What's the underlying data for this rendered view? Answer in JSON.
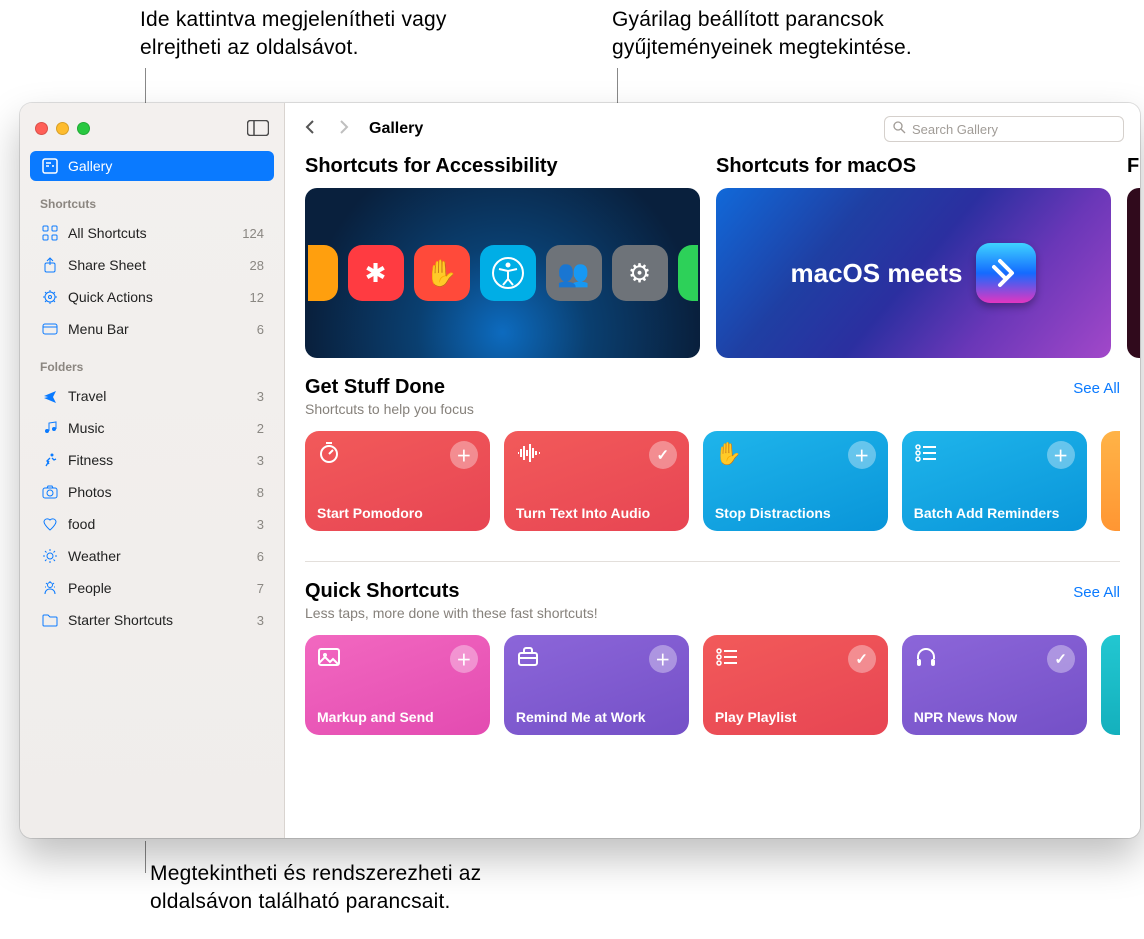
{
  "callouts": {
    "sidebar_toggle": "Ide kattintva megjelenítheti vagy elrejtheti az oldalsávot.",
    "gallery_banner": "Gyárilag beállított parancsok gyűjteményeinek megtekintése.",
    "sidebar_footer": "Megtekintheti és rendszerezheti az oldalsávon található parancsait."
  },
  "toolbar": {
    "title": "Gallery",
    "search_placeholder": "Search Gallery"
  },
  "sidebar": {
    "gallery_label": "Gallery",
    "header_shortcuts": "Shortcuts",
    "header_folders": "Folders",
    "shortcuts": [
      {
        "label": "All Shortcuts",
        "count": "124",
        "icon": "grid"
      },
      {
        "label": "Share Sheet",
        "count": "28",
        "icon": "share"
      },
      {
        "label": "Quick Actions",
        "count": "12",
        "icon": "gear"
      },
      {
        "label": "Menu Bar",
        "count": "6",
        "icon": "menubar"
      }
    ],
    "folders": [
      {
        "label": "Travel",
        "count": "3",
        "icon": "plane"
      },
      {
        "label": "Music",
        "count": "2",
        "icon": "music"
      },
      {
        "label": "Fitness",
        "count": "3",
        "icon": "run"
      },
      {
        "label": "Photos",
        "count": "8",
        "icon": "camera"
      },
      {
        "label": "food",
        "count": "3",
        "icon": "heart"
      },
      {
        "label": "Weather",
        "count": "6",
        "icon": "sun"
      },
      {
        "label": "People",
        "count": "7",
        "icon": "people"
      },
      {
        "label": "Starter Shortcuts",
        "count": "3",
        "icon": "folder"
      }
    ]
  },
  "banners": [
    {
      "title": "Shortcuts for Accessibility"
    },
    {
      "title": "Shortcuts for macOS",
      "text": "macOS meets"
    },
    {
      "title": "F"
    }
  ],
  "sections": [
    {
      "title": "Get Stuff Done",
      "subtitle": "Shortcuts to help you focus",
      "see_all": "See All",
      "cards": [
        {
          "title": "Start Pomodoro",
          "color": "red",
          "icon": "timer",
          "badge": "plus"
        },
        {
          "title": "Turn Text Into Audio",
          "color": "red",
          "icon": "wave",
          "badge": "check"
        },
        {
          "title": "Stop Distractions",
          "color": "blue",
          "icon": "hand",
          "badge": "plus"
        },
        {
          "title": "Batch Add Reminders",
          "color": "blue",
          "icon": "list",
          "badge": "plus"
        }
      ]
    },
    {
      "title": "Quick Shortcuts",
      "subtitle": "Less taps, more done with these fast shortcuts!",
      "see_all": "See All",
      "cards": [
        {
          "title": "Markup and Send",
          "color": "pink",
          "icon": "image",
          "badge": "plus"
        },
        {
          "title": "Remind Me at Work",
          "color": "purple",
          "icon": "briefcase",
          "badge": "plus"
        },
        {
          "title": "Play Playlist",
          "color": "red",
          "icon": "list",
          "badge": "check"
        },
        {
          "title": "NPR News Now",
          "color": "purple",
          "icon": "headphones",
          "badge": "check"
        }
      ]
    }
  ]
}
